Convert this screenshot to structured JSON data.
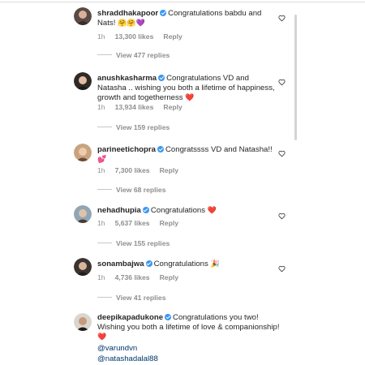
{
  "comments": [
    {
      "username": "shraddhakapoor",
      "text": "Congratulations babdu and Nats!",
      "emoji": "🤗🤗💜",
      "time": "1h",
      "likes": "13,300 likes",
      "reply": "Reply",
      "view_replies": "View 477 replies"
    },
    {
      "username": "anushkasharma",
      "text": "Congratulations VD and Natasha .. wishing you both a lifetime of happiness, growth and togetherness",
      "emoji": "❤️",
      "time": "1h",
      "likes": "13,934 likes",
      "reply": "Reply",
      "view_replies": "View 159 replies"
    },
    {
      "username": "parineetichopra",
      "text": "Congratssss VD and Natasha!!",
      "emoji": "💕",
      "time": "1h",
      "likes": "7,300 likes",
      "reply": "Reply",
      "view_replies": "View 68 replies"
    },
    {
      "username": "nehadhupia",
      "text": "Congratulations",
      "emoji": "❤️",
      "time": "1h",
      "likes": "5,637 likes",
      "reply": "Reply",
      "view_replies": "View 155 replies"
    },
    {
      "username": "sonambajwa",
      "text": "Congratulations",
      "emoji": "🎉",
      "time": "1h",
      "likes": "4,736 likes",
      "reply": "Reply",
      "view_replies": "View 41 replies"
    },
    {
      "username": "deepikapadukone",
      "text": "Congratulations you two! Wishing you both a lifetime of love & companionship!",
      "emoji": "❤️",
      "mention1": "@varundvn",
      "mention2": "@natashadalal88"
    }
  ],
  "colors": {
    "verified": "#3897f0",
    "meta": "#8e8e8e",
    "heart_emoji": "#ed4956"
  },
  "icons": {
    "like": "heart-outline-icon",
    "verified": "verified-badge-icon"
  }
}
